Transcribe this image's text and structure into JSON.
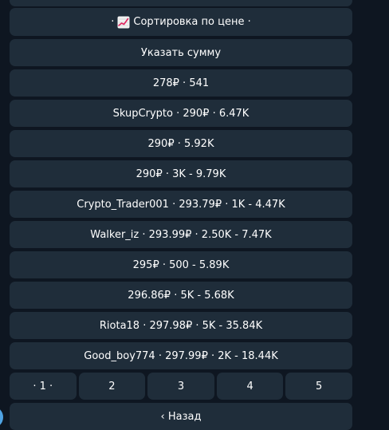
{
  "sort_button": {
    "prefix": "· ",
    "icon": "chart-increasing-icon",
    "label": "Сортировка по цене ·"
  },
  "amount_button": {
    "label": "Указать сумму"
  },
  "offers": [
    {
      "label": "278₽ · 541"
    },
    {
      "label": "SkupCrypto · 290₽ · 6.47K"
    },
    {
      "label": "290₽ · 5.92K"
    },
    {
      "label": "290₽ · 3K - 9.79K"
    },
    {
      "label": "Crypto_Trader001 · 293.79₽ · 1K - 4.47K"
    },
    {
      "label": "Walker_iz · 293.99₽ · 2.50K - 7.47K"
    },
    {
      "label": "295₽ · 500 - 5.89K"
    },
    {
      "label": "296.86₽ · 5K - 5.68K"
    },
    {
      "label": "Riota18 · 297.98₽ · 5K - 35.84K"
    },
    {
      "label": "Good_boy774 · 297.99₽ · 2K - 18.44K"
    }
  ],
  "pagination": [
    {
      "label": "· 1 ·",
      "current": true
    },
    {
      "label": "2"
    },
    {
      "label": "3"
    },
    {
      "label": "4"
    },
    {
      "label": "5"
    }
  ],
  "back_button": {
    "label": "‹ Назад"
  },
  "colors": {
    "background": "#0e1621",
    "button": "#1f2d3a",
    "text": "#ffffff",
    "accent": "#4fa3e3"
  }
}
